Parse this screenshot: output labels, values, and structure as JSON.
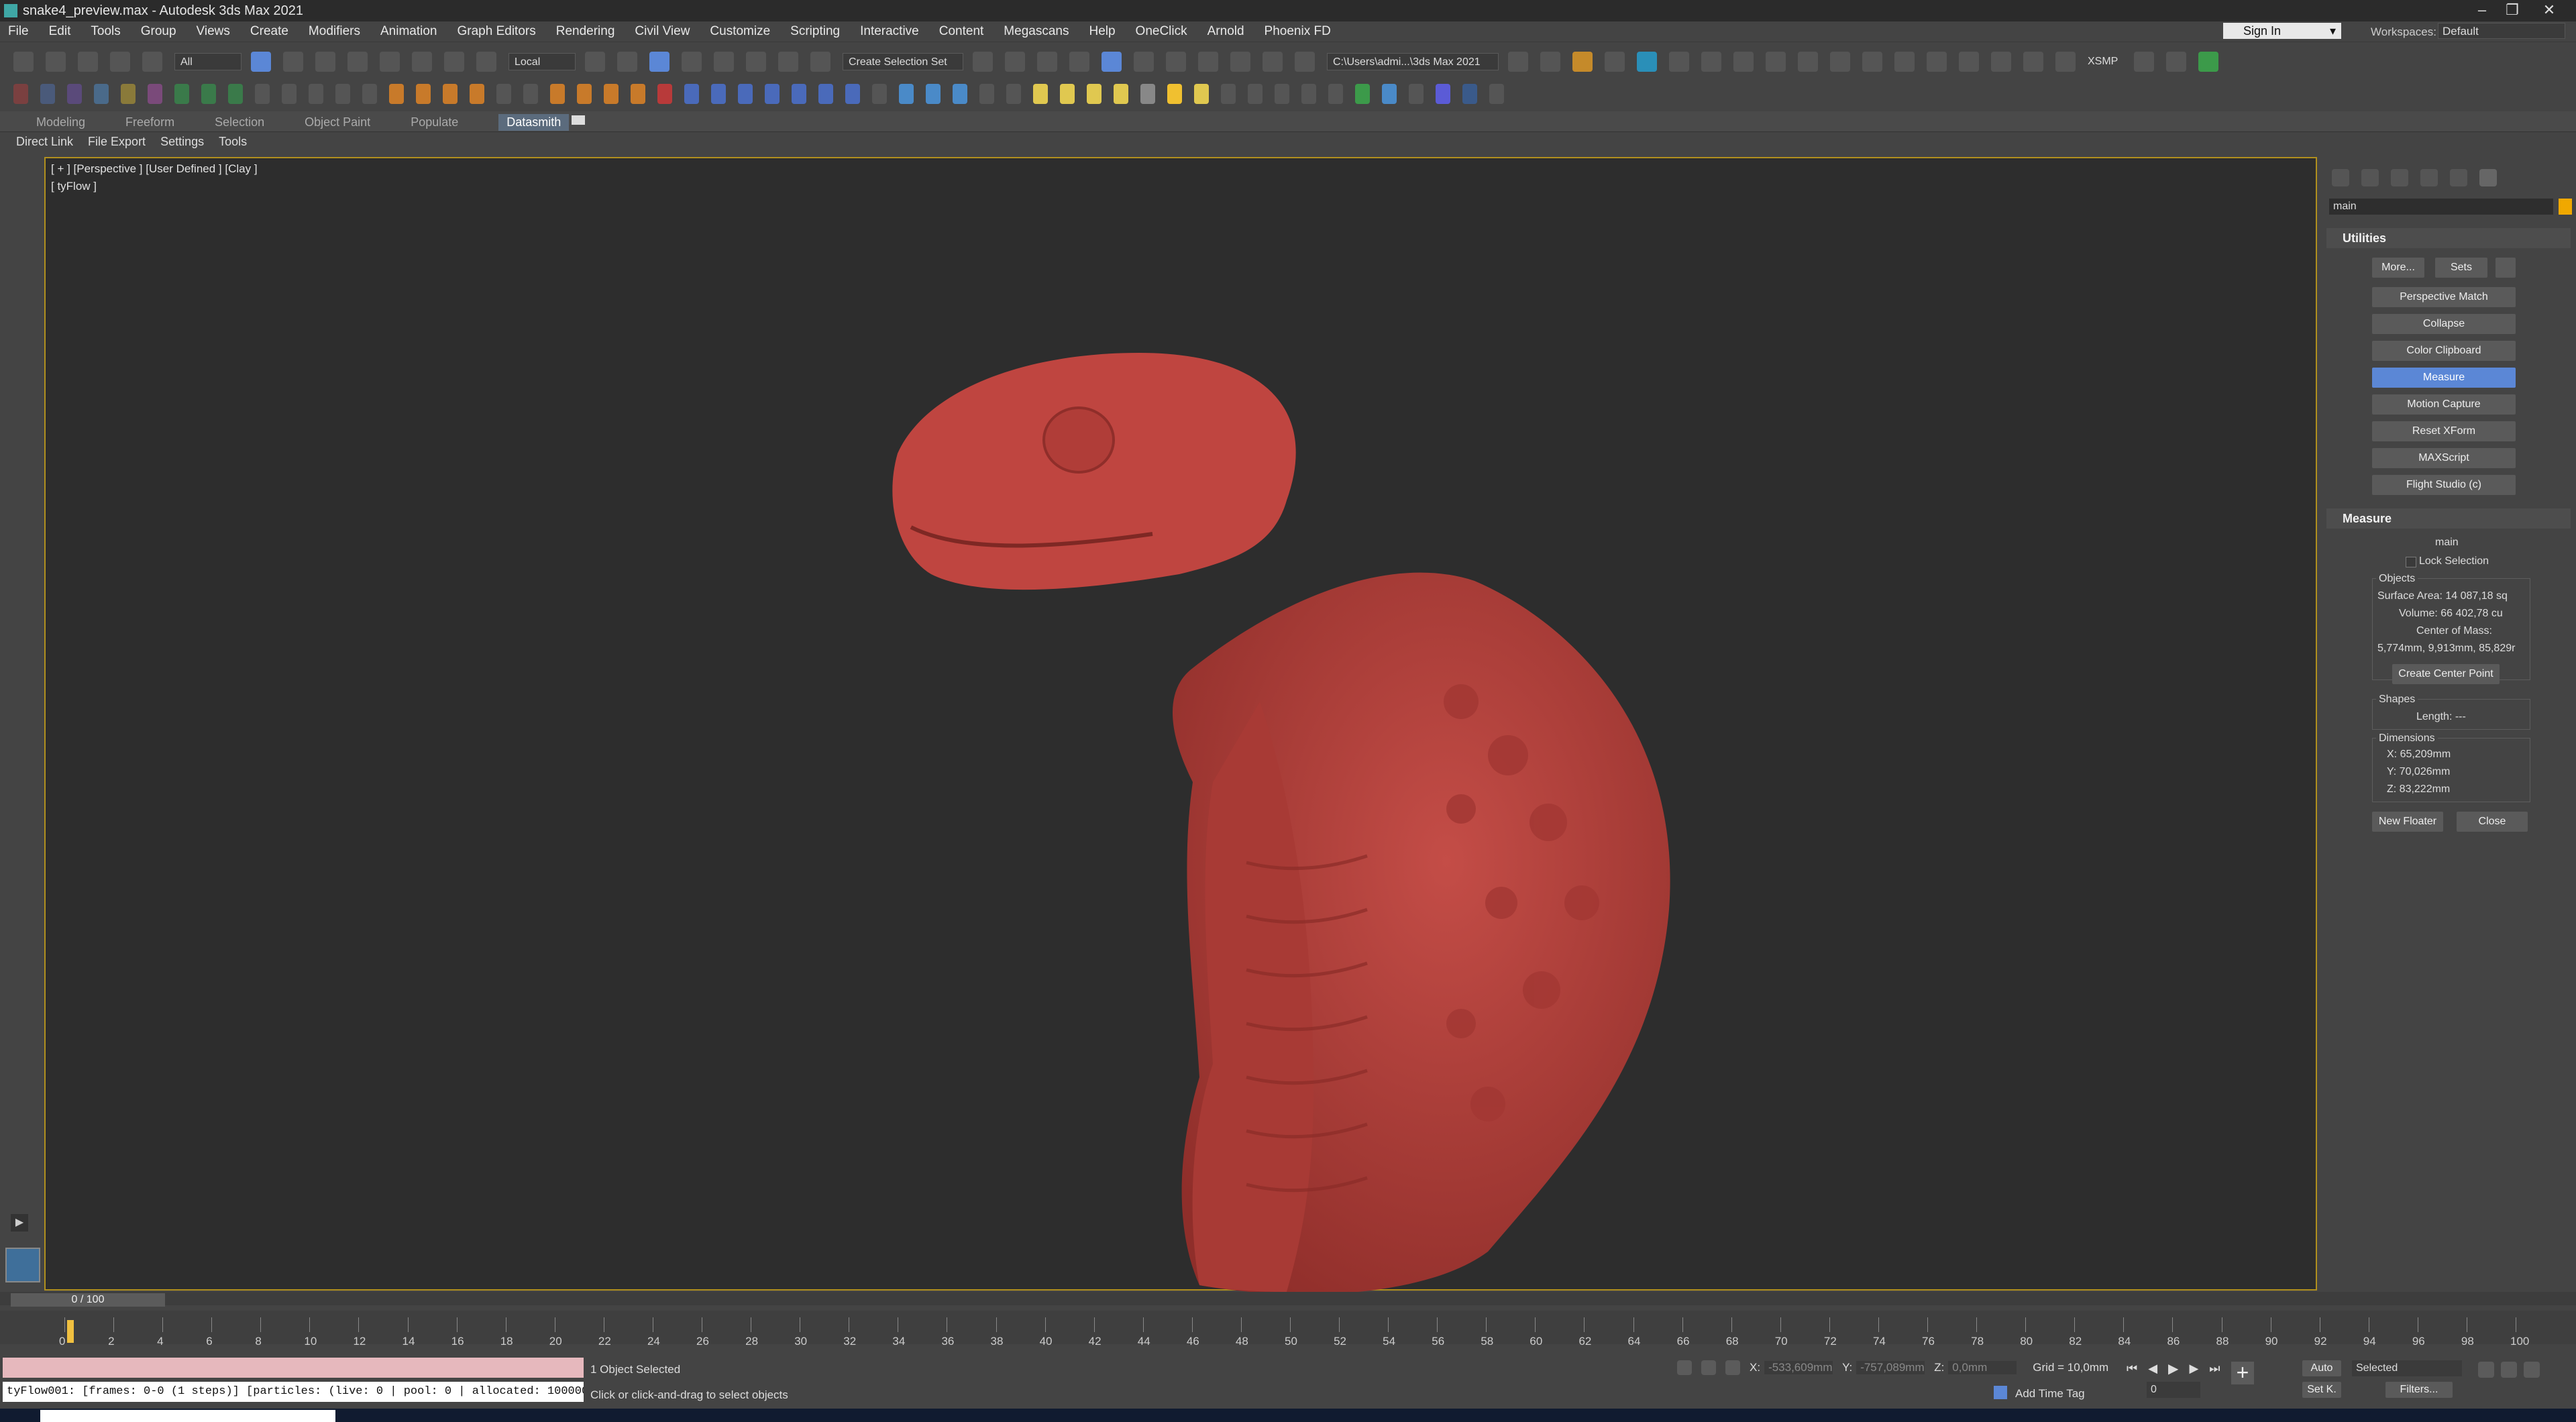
{
  "window": {
    "title": "snake4_preview.max - Autodesk 3ds Max 2021"
  },
  "menu": [
    "File",
    "Edit",
    "Tools",
    "Group",
    "Views",
    "Create",
    "Modifiers",
    "Animation",
    "Graph Editors",
    "Rendering",
    "Civil View",
    "Customize",
    "Scripting",
    "Interactive",
    "Content",
    "Megascans",
    "Help",
    "OneClick",
    "Arnold",
    "Phoenix FD"
  ],
  "account": {
    "sign_in": "Sign In",
    "workspaces_label": "Workspaces:",
    "workspace": "Default"
  },
  "toolbar": {
    "filter": "All",
    "coord": "Local",
    "selection_set": "Create Selection Set",
    "path": "C:\\Users\\admi...\\3ds Max 2021",
    "xsmp": "XSMP"
  },
  "ribbon_tabs": [
    "Modeling",
    "Freeform",
    "Selection",
    "Object Paint",
    "Populate",
    "Datasmith"
  ],
  "ribbon_active": "Datasmith",
  "sub_tabs": [
    "Direct Link",
    "File Export",
    "Settings",
    "Tools"
  ],
  "viewport": {
    "label": "[ + ] [Perspective ] [User Defined ] [Clay ]",
    "sublabel": "[ tyFlow ]"
  },
  "command_panel": {
    "name_field": "main",
    "utilities": {
      "title": "Utilities",
      "more": "More...",
      "sets": "Sets",
      "buttons": [
        "Perspective Match",
        "Collapse",
        "Color Clipboard",
        "Measure",
        "Motion Capture",
        "Reset XForm",
        "MAXScript",
        "Flight Studio (c)"
      ],
      "selected": "Measure"
    },
    "measure": {
      "title": "Measure",
      "object_name": "main",
      "lock_selection": "Lock Selection",
      "objects_label": "Objects",
      "surface_area": "Surface Area: 14 087,18 sq",
      "volume": "Volume: 66 402,78 cu",
      "center_label": "Center of Mass:",
      "center_value": "5,774mm, 9,913mm, 85,829r",
      "create_center": "Create Center Point",
      "shapes_label": "Shapes",
      "length": "Length: ---",
      "dimensions_label": "Dimensions",
      "dim_x": "X:  65,209mm",
      "dim_y": "Y:  70,026mm",
      "dim_z": "Z:  83,222mm",
      "new_floater": "New Floater",
      "close": "Close"
    }
  },
  "timeline": {
    "frame": "0 / 100",
    "ticks": [
      "0",
      "2",
      "4",
      "6",
      "8",
      "10",
      "12",
      "14",
      "16",
      "18",
      "20",
      "22",
      "24",
      "26",
      "28",
      "30",
      "32",
      "34",
      "36",
      "38",
      "40",
      "42",
      "44",
      "46",
      "48",
      "50",
      "52",
      "54",
      "56",
      "58",
      "60",
      "62",
      "64",
      "66",
      "68",
      "70",
      "72",
      "74",
      "76",
      "78",
      "80",
      "82",
      "84",
      "86",
      "88",
      "90",
      "92",
      "94",
      "96",
      "98",
      "100"
    ]
  },
  "status": {
    "listener_text": "tyFlow001: [frames: 0-0 (1 steps)] [particles: (live: 0 | pool: 0 | allocated: 100000",
    "selection": "1 Object Selected",
    "prompt": "Click or click-and-drag to select objects",
    "x_label": "X:",
    "x_val": "-533,609mm",
    "y_label": "Y:",
    "y_val": "-757,089mm",
    "z_label": "Z:",
    "z_val": "0,0mm",
    "grid": "Grid = 10,0mm",
    "add_time_tag": "Add Time Tag",
    "auto": "Auto",
    "set_k": "Set K.",
    "selected": "Selected",
    "filters": "Filters...",
    "frame_field": "0"
  },
  "colors": {
    "accent": "#5b87d6",
    "viewport_border": "#b08f1e",
    "model": "#b9413d"
  }
}
